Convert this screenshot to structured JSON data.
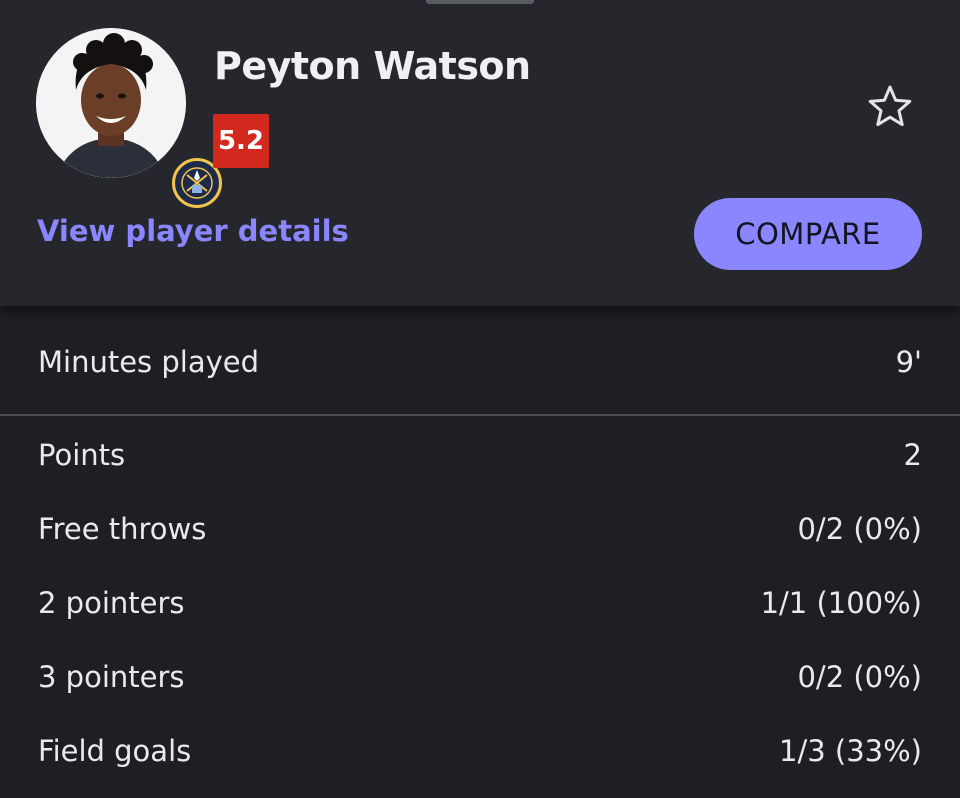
{
  "player": {
    "name": "Peyton Watson",
    "rating": "5.2",
    "view_details_label": "View player details",
    "compare_label": "COMPARE"
  },
  "colors": {
    "accent": "#8a86ff",
    "rating_bg": "#d1291d",
    "card_bg": "#26272c",
    "page_bg": "#1e1f23"
  },
  "icons": {
    "favorite": "star-outline-icon",
    "team": "denver-nuggets-logo"
  },
  "minutes": {
    "label": "Minutes played",
    "value": "9'"
  },
  "stats": [
    {
      "label": "Points",
      "value": "2"
    },
    {
      "label": "Free throws",
      "value": "0/2 (0%)"
    },
    {
      "label": "2 pointers",
      "value": "1/1 (100%)"
    },
    {
      "label": "3 pointers",
      "value": "0/2 (0%)"
    },
    {
      "label": "Field goals",
      "value": "1/3 (33%)"
    }
  ]
}
